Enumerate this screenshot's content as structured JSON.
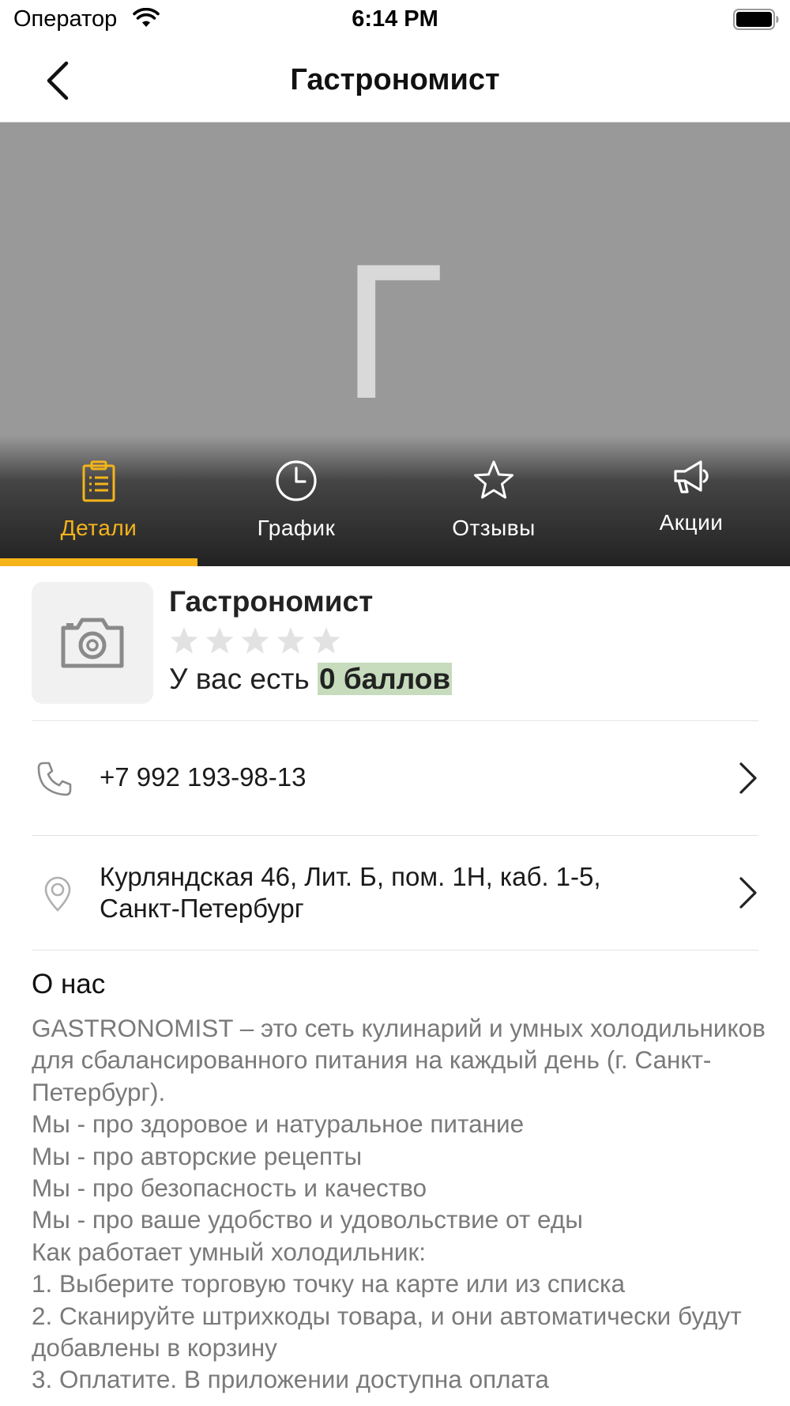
{
  "status_bar": {
    "carrier": "Оператор",
    "time": "6:14 PM"
  },
  "nav": {
    "title": "Гастрономист"
  },
  "hero": {
    "placeholder_letter": "Г"
  },
  "tabs": [
    {
      "label": "Детали",
      "icon": "clipboard-list-icon",
      "active": true
    },
    {
      "label": "График",
      "icon": "clock-icon",
      "active": false
    },
    {
      "label": "Отзывы",
      "icon": "star-icon",
      "active": false
    },
    {
      "label": "Акции",
      "icon": "megaphone-icon",
      "active": false
    }
  ],
  "place": {
    "name": "Гастрономист",
    "rating": 0,
    "rating_max": 5,
    "points_prefix": "У вас есть ",
    "points_value": "0 баллов"
  },
  "contacts": {
    "phone": "+7 992 193-98-13",
    "address": "Курляндская 46, Лит. Б, пом. 1Н, каб. 1-5, Санкт-Петербург"
  },
  "about": {
    "title": "О нас",
    "text": "GASTRONOMIST – это сеть кулинарий и умных холодильников для сбалансированного питания на каждый день (г. Санкт-Петербург).\nМы - про здоровое и натуральное питание\nМы - про авторские рецепты\nМы - про безопасность и качество\nМы - про ваше удобство и удовольствие от еды\nКак работает умный холодильник:\n1.     Выберите торговую точку на карте или из списка\n2.     Сканируйте штрихкоды товара, и они автоматически будут добавлены в корзину\n3.     Оплатите. В приложении доступна оплата"
  },
  "colors": {
    "accent": "#f4b41a",
    "hero_bg": "#999999",
    "points_highlight": "#c6dcbd",
    "muted_text": "#7a7a7a"
  }
}
